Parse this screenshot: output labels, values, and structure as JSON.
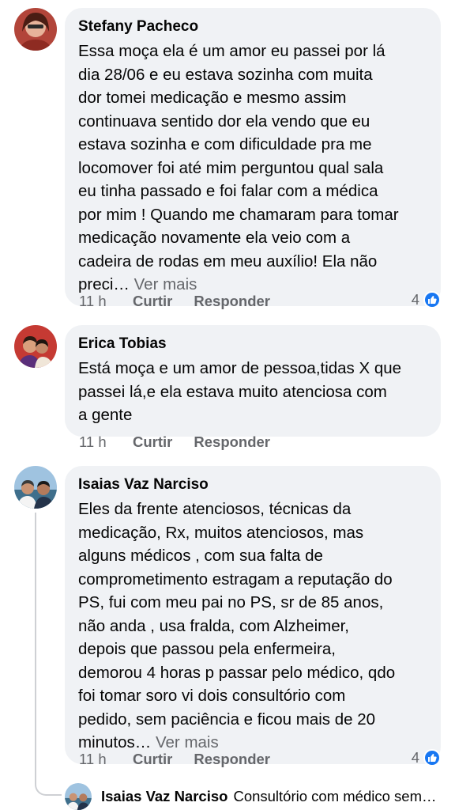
{
  "comments": [
    {
      "author": "Stefany Pacheco",
      "lines": [
        "Essa moça ela é um amor eu passei por lá",
        "dia 28/06 e eu estava sozinha com muita",
        "dor tomei medicação e mesmo assim",
        "continuava sentido dor ela vendo que eu",
        "estava sozinha e com dificuldade pra me",
        "locomover foi até mim perguntou qual sala",
        "eu tinha passado e foi falar com a médica",
        "por mim ! Quando me chamaram para tomar",
        "medicação novamente ela veio com a",
        "cadeira de rodas em meu auxílio! Ela não",
        "preci…"
      ],
      "see_more": "Ver mais",
      "time": "11 h",
      "like": "Curtir",
      "reply": "Responder",
      "reaction_count": "4"
    },
    {
      "author": "Erica Tobias",
      "lines": [
        "Está moça e um amor de pessoa,tidas X que",
        "passei lá,e ela estava muito atenciosa com",
        "a gente"
      ],
      "time": "11 h",
      "like": "Curtir",
      "reply": "Responder"
    },
    {
      "author": "Isaias Vaz Narciso",
      "lines": [
        "Eles da frente atenciosos, técnicas da",
        "medicação,  Rx, muitos atenciosos, mas",
        "alguns médicos , com sua falta de",
        "comprometimento estragam a reputação do",
        "PS, fui com meu pai no PS,  sr de 85 anos,",
        "não anda , usa fralda, com Alzheimer,",
        "depois que passou pela enfermeira,",
        "demorou 4 horas p passar pelo médico, qdo",
        "foi tomar soro vi dois consultório com",
        "pedido,  sem paciência e ficou mais de 20",
        "minutos…"
      ],
      "see_more": "Ver mais",
      "time": "11 h",
      "like": "Curtir",
      "reply": "Responder",
      "reaction_count": "4"
    }
  ],
  "reply_preview": {
    "author": "Isaias Vaz Narciso",
    "text": "Consultório com médico sem…"
  },
  "colors": {
    "bubble": "#f0f2f5",
    "secondary_text": "#65676b",
    "like_blue": "#1877f2"
  }
}
